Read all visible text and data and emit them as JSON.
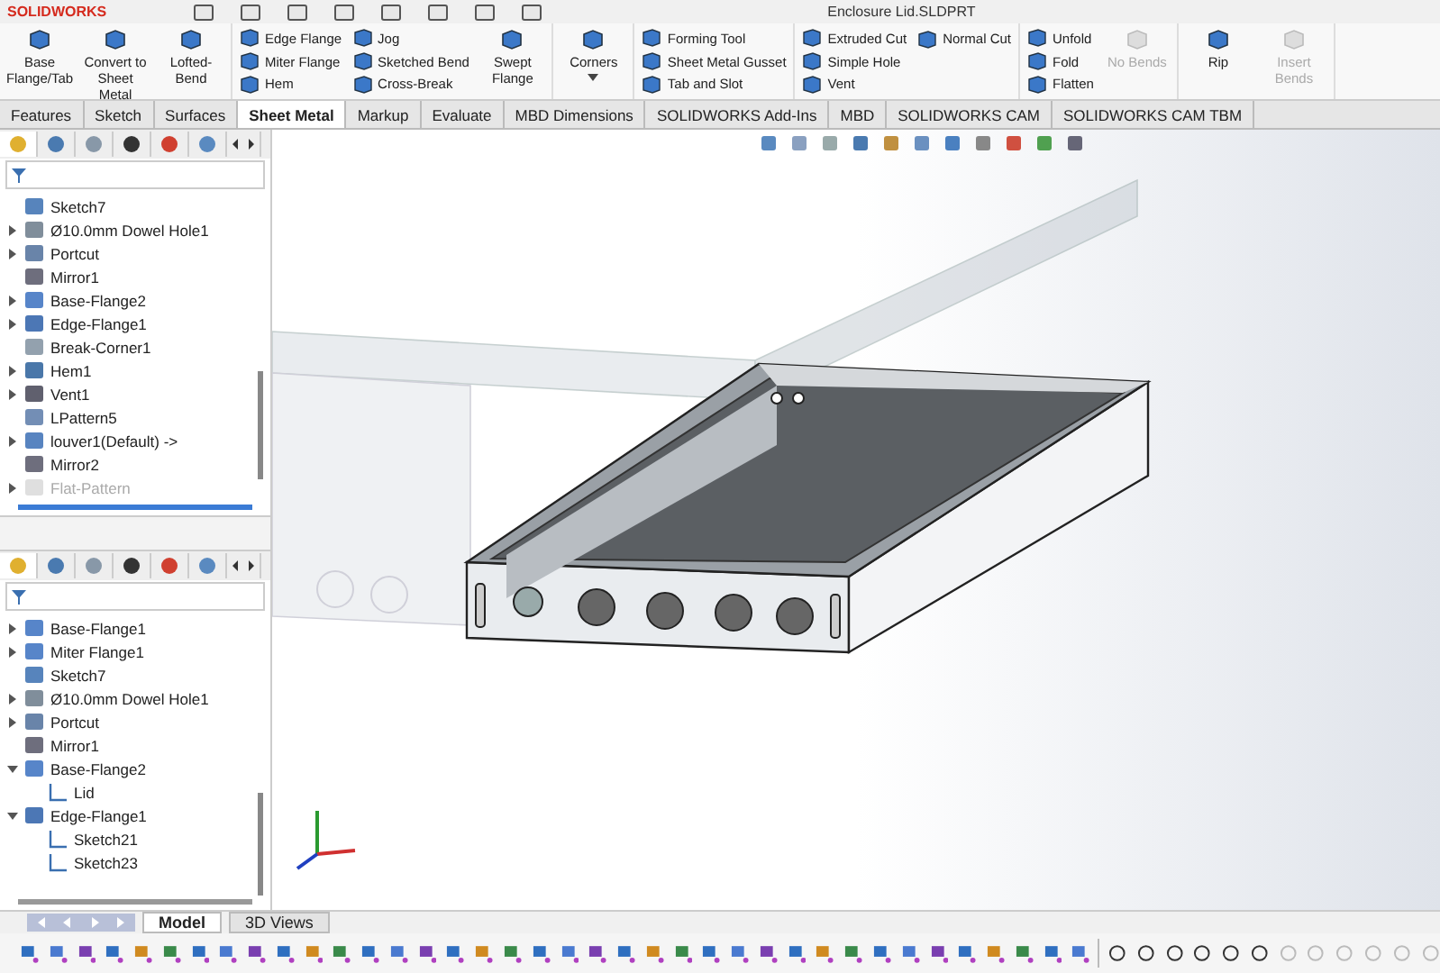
{
  "window": {
    "brand": "SOLIDWORKS",
    "title": "Enclosure Lid.SLDPRT"
  },
  "ribbon": {
    "groups": [
      {
        "columns": [
          {
            "kind": "large",
            "items": [
              {
                "label": "Base Flange/Tab",
                "disabled": false
              }
            ]
          },
          {
            "kind": "large",
            "items": [
              {
                "label": "Convert to Sheet Metal",
                "disabled": false
              }
            ]
          },
          {
            "kind": "large",
            "items": [
              {
                "label": "Lofted-Bend",
                "disabled": false
              }
            ]
          }
        ]
      },
      {
        "columns": [
          {
            "kind": "small",
            "items": [
              {
                "label": "Edge Flange",
                "disabled": false
              },
              {
                "label": "Miter Flange",
                "disabled": false
              },
              {
                "label": "Hem",
                "disabled": false
              }
            ]
          },
          {
            "kind": "small",
            "items": [
              {
                "label": "Jog",
                "disabled": false
              },
              {
                "label": "Sketched Bend",
                "disabled": false
              },
              {
                "label": "Cross-Break",
                "disabled": false
              }
            ]
          },
          {
            "kind": "large",
            "items": [
              {
                "label": "Swept Flange",
                "disabled": false
              }
            ]
          }
        ]
      },
      {
        "columns": [
          {
            "kind": "dropdown",
            "items": [
              {
                "label": "Corners",
                "disabled": false
              }
            ]
          }
        ]
      },
      {
        "columns": [
          {
            "kind": "small",
            "items": [
              {
                "label": "Forming Tool",
                "disabled": false
              },
              {
                "label": "Sheet Metal Gusset",
                "disabled": false
              },
              {
                "label": "Tab and Slot",
                "disabled": false
              }
            ]
          }
        ]
      },
      {
        "columns": [
          {
            "kind": "small",
            "items": [
              {
                "label": "Extruded Cut",
                "disabled": false
              },
              {
                "label": "Simple Hole",
                "disabled": false
              },
              {
                "label": "Vent",
                "disabled": false
              }
            ]
          },
          {
            "kind": "small",
            "items": [
              {
                "label": "Normal Cut",
                "disabled": false
              }
            ]
          }
        ]
      },
      {
        "columns": [
          {
            "kind": "small",
            "items": [
              {
                "label": "Unfold",
                "disabled": false
              },
              {
                "label": "Fold",
                "disabled": false
              },
              {
                "label": "Flatten",
                "disabled": false
              }
            ]
          },
          {
            "kind": "large",
            "items": [
              {
                "label": "No Bends",
                "disabled": true
              }
            ]
          }
        ]
      },
      {
        "columns": [
          {
            "kind": "large",
            "items": [
              {
                "label": "Rip",
                "disabled": false
              }
            ]
          },
          {
            "kind": "large",
            "items": [
              {
                "label": "Insert Bends",
                "disabled": true
              }
            ]
          }
        ]
      }
    ]
  },
  "tabs": [
    {
      "label": "Features",
      "selected": false
    },
    {
      "label": "Sketch",
      "selected": false
    },
    {
      "label": "Surfaces",
      "selected": false
    },
    {
      "label": "Sheet Metal",
      "selected": true
    },
    {
      "label": "Markup",
      "selected": false
    },
    {
      "label": "Evaluate",
      "selected": false
    },
    {
      "label": "MBD Dimensions",
      "selected": false
    },
    {
      "label": "SOLIDWORKS Add-Ins",
      "selected": false
    },
    {
      "label": "MBD",
      "selected": false
    },
    {
      "label": "SOLIDWORKS CAM",
      "selected": false
    },
    {
      "label": "SOLIDWORKS CAM TBM",
      "selected": false
    }
  ],
  "trees": [
    {
      "items": [
        {
          "label": "Sketch7",
          "kind": "sketch",
          "disabled": false
        },
        {
          "label": "Ø10.0mm Dowel Hole1",
          "kind": "hole",
          "expanded": false,
          "disabled": false
        },
        {
          "label": "Portcut",
          "kind": "cut",
          "expanded": false,
          "disabled": false
        },
        {
          "label": "Mirror1",
          "kind": "mirror",
          "disabled": false
        },
        {
          "label": "Base-Flange2",
          "kind": "flange",
          "expanded": false,
          "disabled": false
        },
        {
          "label": "Edge-Flange1",
          "kind": "edge",
          "expanded": false,
          "disabled": false
        },
        {
          "label": "Break-Corner1",
          "kind": "corner",
          "disabled": false
        },
        {
          "label": "Hem1",
          "kind": "hem",
          "expanded": false,
          "disabled": false
        },
        {
          "label": "Vent1",
          "kind": "vent",
          "expanded": false,
          "disabled": false
        },
        {
          "label": "LPattern5",
          "kind": "pattern",
          "disabled": false
        },
        {
          "label": "louver1(Default) ->",
          "kind": "louver",
          "expanded": false,
          "disabled": false
        },
        {
          "label": "Mirror2",
          "kind": "mirror",
          "disabled": false
        },
        {
          "label": "Flat-Pattern",
          "kind": "flat",
          "expanded": false,
          "disabled": true
        }
      ]
    },
    {
      "items": [
        {
          "label": "Base-Flange1",
          "kind": "flange",
          "expanded": false,
          "disabled": false
        },
        {
          "label": "Miter Flange1",
          "kind": "miter",
          "expanded": false,
          "disabled": false
        },
        {
          "label": "Sketch7",
          "kind": "sketch",
          "disabled": false
        },
        {
          "label": "Ø10.0mm Dowel Hole1",
          "kind": "hole",
          "expanded": false,
          "disabled": false
        },
        {
          "label": "Portcut",
          "kind": "cut",
          "expanded": false,
          "disabled": false
        },
        {
          "label": "Mirror1",
          "kind": "mirror",
          "disabled": false
        },
        {
          "label": "Base-Flange2",
          "kind": "flange",
          "expanded": true,
          "disabled": false,
          "children": [
            {
              "label": "Lid",
              "kind": "sketch",
              "disabled": false
            }
          ]
        },
        {
          "label": "Edge-Flange1",
          "kind": "edge",
          "expanded": true,
          "disabled": false,
          "children": [
            {
              "label": "Sketch21",
              "kind": "sketch",
              "disabled": false
            },
            {
              "label": "Sketch23",
              "kind": "sketch",
              "disabled": false
            }
          ]
        }
      ]
    }
  ],
  "bottom_tabs": [
    {
      "label": "Model",
      "selected": true
    },
    {
      "label": "3D Views",
      "selected": false
    }
  ]
}
